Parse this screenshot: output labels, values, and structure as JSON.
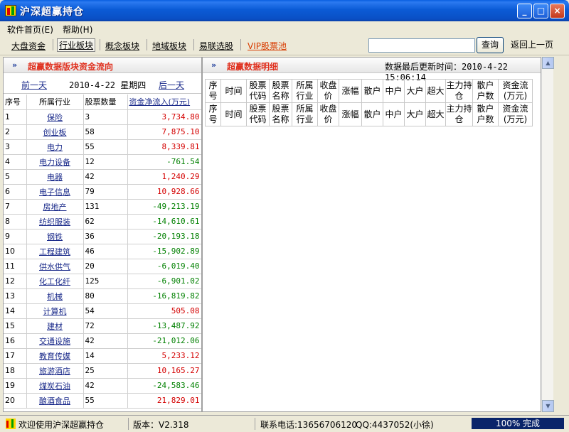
{
  "window": {
    "title": "沪深超赢持仓"
  },
  "menu": {
    "home": "软件首页(E)",
    "help": "帮助(H)"
  },
  "toolbar": {
    "items": [
      "大盘资金",
      "行业板块",
      "概念板块",
      "地域板块",
      "易联选股",
      "VIP股票池"
    ],
    "search_value": "",
    "query_label": "查询",
    "back_label": "返回上一页"
  },
  "left": {
    "title": "超赢数据版块资金流向",
    "prev_day": "前一天",
    "date": "2010-4-22 星期四",
    "next_day": "后一天",
    "headers": [
      "序号",
      "所属行业",
      "股票数量",
      "资金净流入(万元)"
    ],
    "rows": [
      {
        "no": "1",
        "industry": "保险",
        "count": "3",
        "flow": "3,734.80",
        "dir": "pos"
      },
      {
        "no": "2",
        "industry": "创业板",
        "count": "58",
        "flow": "7,875.10",
        "dir": "pos"
      },
      {
        "no": "3",
        "industry": "电力",
        "count": "55",
        "flow": "8,339.81",
        "dir": "pos"
      },
      {
        "no": "4",
        "industry": "电力设备",
        "count": "12",
        "flow": "-761.54",
        "dir": "neg"
      },
      {
        "no": "5",
        "industry": "电器",
        "count": "42",
        "flow": "1,240.29",
        "dir": "pos"
      },
      {
        "no": "6",
        "industry": "电子信息",
        "count": "79",
        "flow": "10,928.66",
        "dir": "pos"
      },
      {
        "no": "7",
        "industry": "房地产",
        "count": "131",
        "flow": "-49,213.19",
        "dir": "neg"
      },
      {
        "no": "8",
        "industry": "纺织服装",
        "count": "62",
        "flow": "-14,610.61",
        "dir": "neg"
      },
      {
        "no": "9",
        "industry": "钢铁",
        "count": "36",
        "flow": "-20,193.18",
        "dir": "neg"
      },
      {
        "no": "10",
        "industry": "工程建筑",
        "count": "46",
        "flow": "-15,902.89",
        "dir": "neg"
      },
      {
        "no": "11",
        "industry": "供水供气",
        "count": "20",
        "flow": "-6,019.40",
        "dir": "neg"
      },
      {
        "no": "12",
        "industry": "化工化纤",
        "count": "125",
        "flow": "-6,901.02",
        "dir": "neg"
      },
      {
        "no": "13",
        "industry": "机械",
        "count": "80",
        "flow": "-16,819.82",
        "dir": "neg"
      },
      {
        "no": "14",
        "industry": "计算机",
        "count": "54",
        "flow": "505.08",
        "dir": "pos"
      },
      {
        "no": "15",
        "industry": "建材",
        "count": "72",
        "flow": "-13,487.92",
        "dir": "neg"
      },
      {
        "no": "16",
        "industry": "交通设施",
        "count": "42",
        "flow": "-21,012.06",
        "dir": "neg"
      },
      {
        "no": "17",
        "industry": "教育传媒",
        "count": "14",
        "flow": "5,233.12",
        "dir": "pos"
      },
      {
        "no": "18",
        "industry": "旅游酒店",
        "count": "25",
        "flow": "10,165.27",
        "dir": "pos"
      },
      {
        "no": "19",
        "industry": "煤炭石油",
        "count": "42",
        "flow": "-24,583.46",
        "dir": "neg"
      },
      {
        "no": "20",
        "industry": "酿酒食品",
        "count": "55",
        "flow": "21,829.01",
        "dir": "pos"
      }
    ]
  },
  "right": {
    "title": "超赢数据明细",
    "last_update": "数据最后更新时间：2010-4-22 15:06:14",
    "headers": [
      "序号",
      "时间",
      "股票代码",
      "股票名称",
      "所属行业",
      "收盘价",
      "涨幅",
      "散户",
      "中户",
      "大户",
      "超大",
      "主力持仓",
      "散户户数",
      "资金流(万元)"
    ]
  },
  "status": {
    "welcome": "欢迎使用沪深超赢持仓",
    "version": "版本：V2.318",
    "phone": "联系电话:13656706120",
    "qq": "QQ:4437052(小徐)",
    "progress": "100% 完成"
  },
  "colors": {
    "positive": "#d40000",
    "negative": "#008000",
    "header_accent": "#e0301e",
    "vip": "#d83c00"
  }
}
